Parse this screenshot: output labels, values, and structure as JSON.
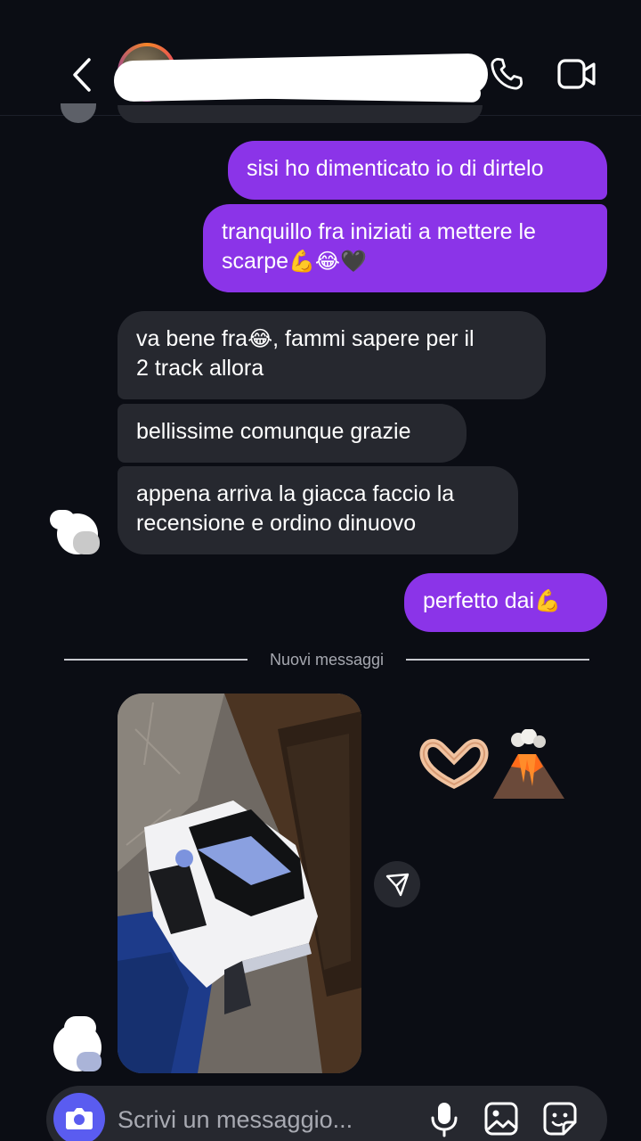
{
  "header": {
    "back": "back-icon",
    "call": "phone-icon",
    "video": "video-camera-icon"
  },
  "messages": [
    {
      "side": "sent",
      "text": "sisi ho dimenticato io di dirtelo"
    },
    {
      "side": "sent",
      "line1": "tranquillo fra iniziati a mettere le",
      "line2": "scarpe",
      "emojis": "💪😂🖤"
    },
    {
      "side": "received",
      "line1a": "va bene fra",
      "emoji": "😂",
      "line1b": ", fammi sapere per il",
      "line2": "2 track allora"
    },
    {
      "side": "received",
      "text": "bellissime comunque grazie"
    },
    {
      "side": "received",
      "line1": "appena arriva la giacca faccio la",
      "line2": "recensione e ordino dinuovo"
    },
    {
      "side": "sent",
      "text": "perfetto dai",
      "emoji": "💪"
    }
  ],
  "divider": {
    "label": "Nuovi messaggi"
  },
  "reaction": {
    "emojis": "🫶🌋"
  },
  "composer": {
    "placeholder": "Scrivi un messaggio...",
    "camera": "camera-icon",
    "mic": "microphone-icon",
    "gallery": "image-icon",
    "sticker": "sticker-icon"
  },
  "colors": {
    "background": "#0b0d14",
    "sent_bubble": "#8b34e8",
    "received_bubble": "#26282f",
    "camera_button": "#5a5cf0"
  }
}
